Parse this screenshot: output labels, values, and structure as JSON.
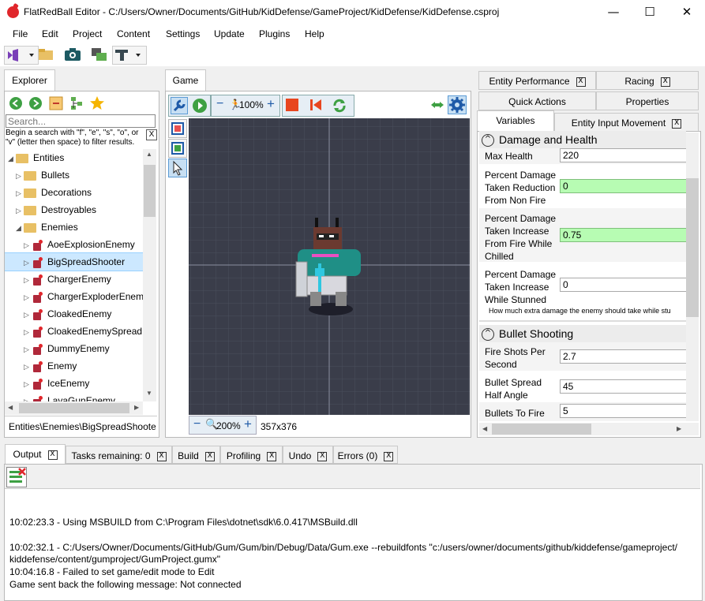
{
  "window": {
    "title": "FlatRedBall Editor - C:/Users/Owner/Documents/GitHub/KidDefense/GameProject/KidDefense/KidDefense.csproj",
    "minimize": "—",
    "maximize": "☐",
    "close": "✕"
  },
  "menu": [
    "File",
    "Edit",
    "Project",
    "Content",
    "Settings",
    "Update",
    "Plugins",
    "Help"
  ],
  "explorer": {
    "tab": "Explorer",
    "search_placeholder": "Search...",
    "search_hint": "Begin a search with \"f\", \"e\", \"s\", \"o\", or \"v\" (letter then space) to filter results.",
    "hint_close": "X",
    "tree": [
      {
        "label": "Entities",
        "type": "folder",
        "indent": 0,
        "expanded": true
      },
      {
        "label": "Bullets",
        "type": "folder",
        "indent": 1
      },
      {
        "label": "Decorations",
        "type": "folder",
        "indent": 1
      },
      {
        "label": "Destroyables",
        "type": "folder",
        "indent": 1
      },
      {
        "label": "Enemies",
        "type": "folder",
        "indent": 1,
        "expanded": true
      },
      {
        "label": "AoeExplosionEnemy",
        "type": "entity",
        "indent": 2
      },
      {
        "label": "BigSpreadShooter",
        "type": "entity",
        "indent": 2,
        "selected": true
      },
      {
        "label": "ChargerEnemy",
        "type": "entity",
        "indent": 2
      },
      {
        "label": "ChargerExploderEnemy",
        "type": "entity",
        "indent": 2
      },
      {
        "label": "CloakedEnemy",
        "type": "entity",
        "indent": 2
      },
      {
        "label": "CloakedEnemySpread",
        "type": "entity",
        "indent": 2
      },
      {
        "label": "DummyEnemy",
        "type": "entity",
        "indent": 2
      },
      {
        "label": "Enemy",
        "type": "entity",
        "indent": 2
      },
      {
        "label": "IceEnemy",
        "type": "entity",
        "indent": 2
      },
      {
        "label": "LavaGunEnemy",
        "type": "entity",
        "indent": 2
      }
    ],
    "path": "Entities\\Enemies\\BigSpreadShooter"
  },
  "game": {
    "tab": "Game",
    "zoom_top": "100%",
    "zoom_bottom": "200%",
    "resolution": "357x376"
  },
  "right_tabs": {
    "row1": [
      {
        "label": "Entity Performance",
        "close": "X"
      },
      {
        "label": "Racing",
        "close": "X"
      }
    ],
    "row2": [
      "Quick Actions",
      "Properties"
    ],
    "row3": [
      {
        "label": "Variables"
      },
      {
        "label": "Entity Input Movement",
        "close": "X"
      }
    ]
  },
  "variables": {
    "section1": "Damage and Health",
    "max_health_label": "Max Health",
    "max_health": "220",
    "pdtr_label": "Percent Damage\nTaken Reduction\nFrom Non Fire",
    "pdtr": "0",
    "pdti_fire_label": "Percent Damage\nTaken Increase\nFrom Fire While\nChilled",
    "pdti_fire": "0.75",
    "pdti_stun_label": "Percent Damage\nTaken Increase\nWhile Stunned",
    "pdti_stun": "0",
    "stun_desc": "How much extra damage the enemy should take while stu",
    "section2": "Bullet Shooting",
    "fire_label": "Fire Shots Per\nSecond",
    "fire": "2.7",
    "spread_label": "Bullet Spread\nHalf Angle",
    "spread": "45",
    "bullets_label": "Bullets To Fire",
    "bullets": "5"
  },
  "bottom_tabs": [
    {
      "label": "Output",
      "close": "X",
      "active": true
    },
    {
      "label": "Tasks remaining: 0",
      "close": "X"
    },
    {
      "label": "Build",
      "close": "X"
    },
    {
      "label": "Profiling",
      "close": "X"
    },
    {
      "label": "Undo",
      "close": "X"
    },
    {
      "label": "Errors (0)",
      "close": "X"
    }
  ],
  "output": [
    "10:02:23.3 - Using MSBUILD from C:\\Program Files\\dotnet\\sdk\\6.0.417\\MSBuild.dll",
    "10:02:32.1 - C:/Users/Owner/Documents/GitHub/Gum/Gum/bin/Debug/Data/Gum.exe --rebuildfonts \"c:/users/owner/documents/github/kiddefense/gameproject/",
    "kiddefense/content/gumproject/GumProject.gumx\"",
    "10:04:16.8 - Failed to set game/edit mode to Edit",
    "Game sent back the following message: Not connected"
  ],
  "colors": {
    "accent": "#0078d7",
    "game_bg": "#3a3d4a",
    "input_green": "#b7fcb3",
    "selection": "#cce8ff"
  }
}
